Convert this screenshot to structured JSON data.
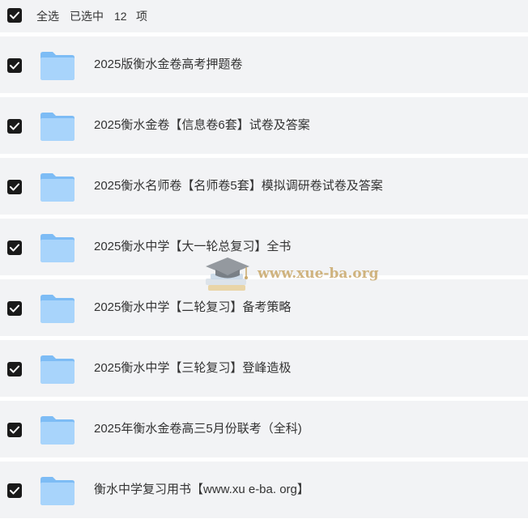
{
  "header": {
    "select_all_label": "全选",
    "selected_prefix": "已选中",
    "selected_count": "12",
    "selected_suffix": "项",
    "select_all_checked": true
  },
  "files": [
    {
      "name": "2025版衡水金卷高考押题卷",
      "checked": true,
      "icon": "folder-icon"
    },
    {
      "name": "2025衡水金卷【信息卷6套】试卷及答案",
      "checked": true,
      "icon": "folder-icon"
    },
    {
      "name": "2025衡水名师卷【名师卷5套】模拟调研卷试卷及答案",
      "checked": true,
      "icon": "folder-icon"
    },
    {
      "name": "2025衡水中学【大一轮总复习】全书",
      "checked": true,
      "icon": "folder-icon"
    },
    {
      "name": "2025衡水中学【二轮复习】备考策略",
      "checked": true,
      "icon": "folder-icon"
    },
    {
      "name": "2025衡水中学【三轮复习】登峰造极",
      "checked": true,
      "icon": "folder-icon"
    },
    {
      "name": "2025年衡水金卷高三5月份联考（全科)",
      "checked": true,
      "icon": "folder-icon"
    },
    {
      "name": "衡水中学复习用书【www.xu e-ba. org】",
      "checked": true,
      "icon": "folder-icon"
    }
  ],
  "watermark": {
    "text": "www.xue-ba.org",
    "icon": "graduation-cap-books-icon"
  },
  "colors": {
    "row_background": "#f2f3f5",
    "checkbox": "#1a1a1a",
    "folder_light": "#a8d4fb",
    "folder_dark": "#7dbcf5",
    "text": "#333333",
    "watermark": "#c9a86a"
  }
}
